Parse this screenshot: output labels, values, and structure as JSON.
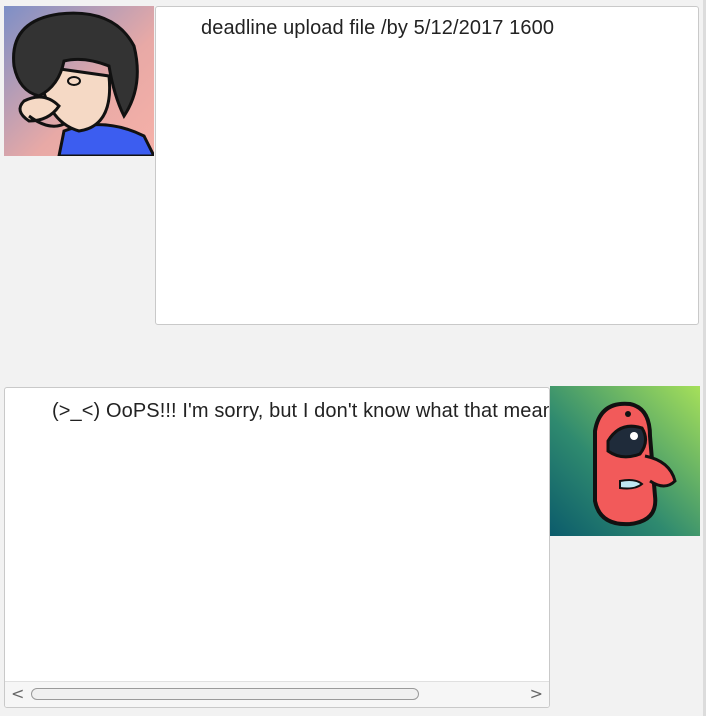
{
  "conversation": {
    "user_message": "deadline upload file /by 5/12/2017 1600",
    "bot_message": "(>_<) OoPS!!! I'm sorry, but I don't know what that means :-("
  },
  "avatars": {
    "user": "user-avatar-cartoon",
    "bot": "bot-avatar-cartoon"
  },
  "scrollbar": {
    "left_arrow": "<",
    "right_arrow": ">"
  }
}
